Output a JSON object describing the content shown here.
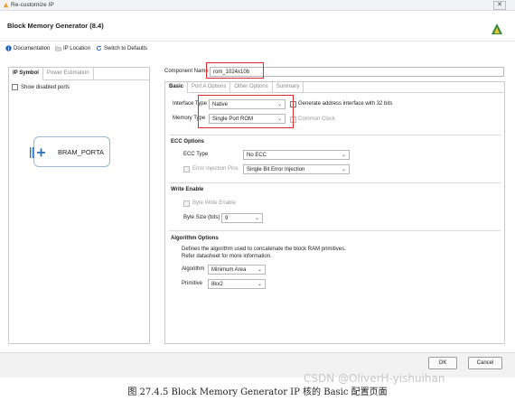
{
  "window": {
    "title": "Re-customize IP",
    "close_glyph": "✕"
  },
  "header": {
    "title": "Block Memory Generator (8.4)",
    "brand_icon": "xilinx-logo-icon"
  },
  "toolbar": {
    "documentation": "Documentation",
    "ip_location": "IP Location",
    "switch_defaults": "Switch to Defaults"
  },
  "left_panel": {
    "tabs": [
      "IP Symbol",
      "Power Estimation"
    ],
    "show_disabled": "Show disabled ports",
    "symbol_label": "BRAM_PORTA"
  },
  "right_panel": {
    "component_name_label": "Component Name",
    "component_name_value": "rom_1024x10b",
    "tabs": [
      "Basic",
      "Port A Options",
      "Other Options",
      "Summary"
    ],
    "interface_type_label": "Interface Type",
    "interface_type_value": "Native",
    "generate_addr_label": "Generate address interface with 32 bits",
    "memory_type_label": "Memory Type",
    "memory_type_value": "Single Port ROM",
    "common_clock_label": "Common Clock",
    "ecc_section": "ECC Options",
    "ecc_type_label": "ECC Type",
    "ecc_type_value": "No ECC",
    "error_injection_label": "Error Injection Pins",
    "error_injection_value": "Single Bit Error Injection",
    "write_enable_section": "Write Enable",
    "byte_write_label": "Byte Write Enable",
    "byte_size_label": "Byte Size (bits)",
    "byte_size_value": "9",
    "algorithm_section": "Algorithm Options",
    "algorithm_desc1": "Defines the algorithm used to concatenate the block RAM primitives.",
    "algorithm_desc2": "Refer datasheet for more information.",
    "algorithm_label": "Algorithm",
    "algorithm_value": "Minimum Area",
    "primitive_label": "Primitive",
    "primitive_value": "8kx2"
  },
  "footer": {
    "ok": "OK",
    "cancel": "Cancel"
  },
  "caption": "图 27.4.5 Block Memory Generator IP 核的 Basic 配置页面",
  "watermark": "CSDN @OliverH-yishuihan",
  "colors": {
    "highlight": "#e0282e",
    "accent": "#2a6fc7"
  }
}
